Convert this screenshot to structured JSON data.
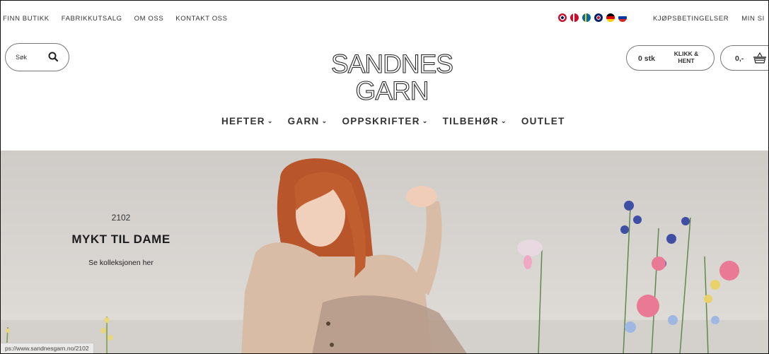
{
  "topbar": {
    "links": [
      "FINN BUTIKK",
      "FABRIKKUTSALG",
      "OM OSS",
      "KONTAKT OSS"
    ],
    "flags": [
      {
        "name": "norway-flag",
        "color": "#c8102e"
      },
      {
        "name": "denmark-flag",
        "color": "#c8102e"
      },
      {
        "name": "sweden-flag",
        "color": "#fecc00"
      },
      {
        "name": "uk-flag",
        "color": "#c8102e"
      },
      {
        "name": "germany-flag",
        "color": "#000000"
      },
      {
        "name": "russia-flag",
        "color": "#0039a6"
      }
    ],
    "right_links": [
      "KJØPSBETINGELSER",
      "MIN SI"
    ]
  },
  "search": {
    "placeholder": "Søk",
    "icon": "search-icon"
  },
  "logo": {
    "line1": "SANDNES",
    "line2": "GARN"
  },
  "cart": {
    "count": "0 stk",
    "click_collect": "KLIKK &",
    "click_collect_2": "HENT"
  },
  "basket": {
    "price": "0,-",
    "icon": "basket-icon"
  },
  "nav": {
    "items": [
      {
        "label": "HEFTER",
        "chevron": "⌄"
      },
      {
        "label": "GARN",
        "chevron": "⌄"
      },
      {
        "label": "OPPSKRIFTER",
        "chevron": "⌄"
      },
      {
        "label": "TILBEHØR",
        "chevron": "⌄"
      },
      {
        "label": "OUTLET",
        "chevron": ""
      }
    ]
  },
  "hero": {
    "number": "2102",
    "title": "MYKT TIL DAME",
    "cta": "Se kolleksjonen her"
  },
  "status": {
    "url": "ps://www.sandnesgarn.no/2102"
  },
  "colors": {
    "text": "#333333",
    "border": "#777777",
    "hero_bg": "#d9d6d2",
    "hair": "#b8552a",
    "sweater": "#d8bca6"
  }
}
